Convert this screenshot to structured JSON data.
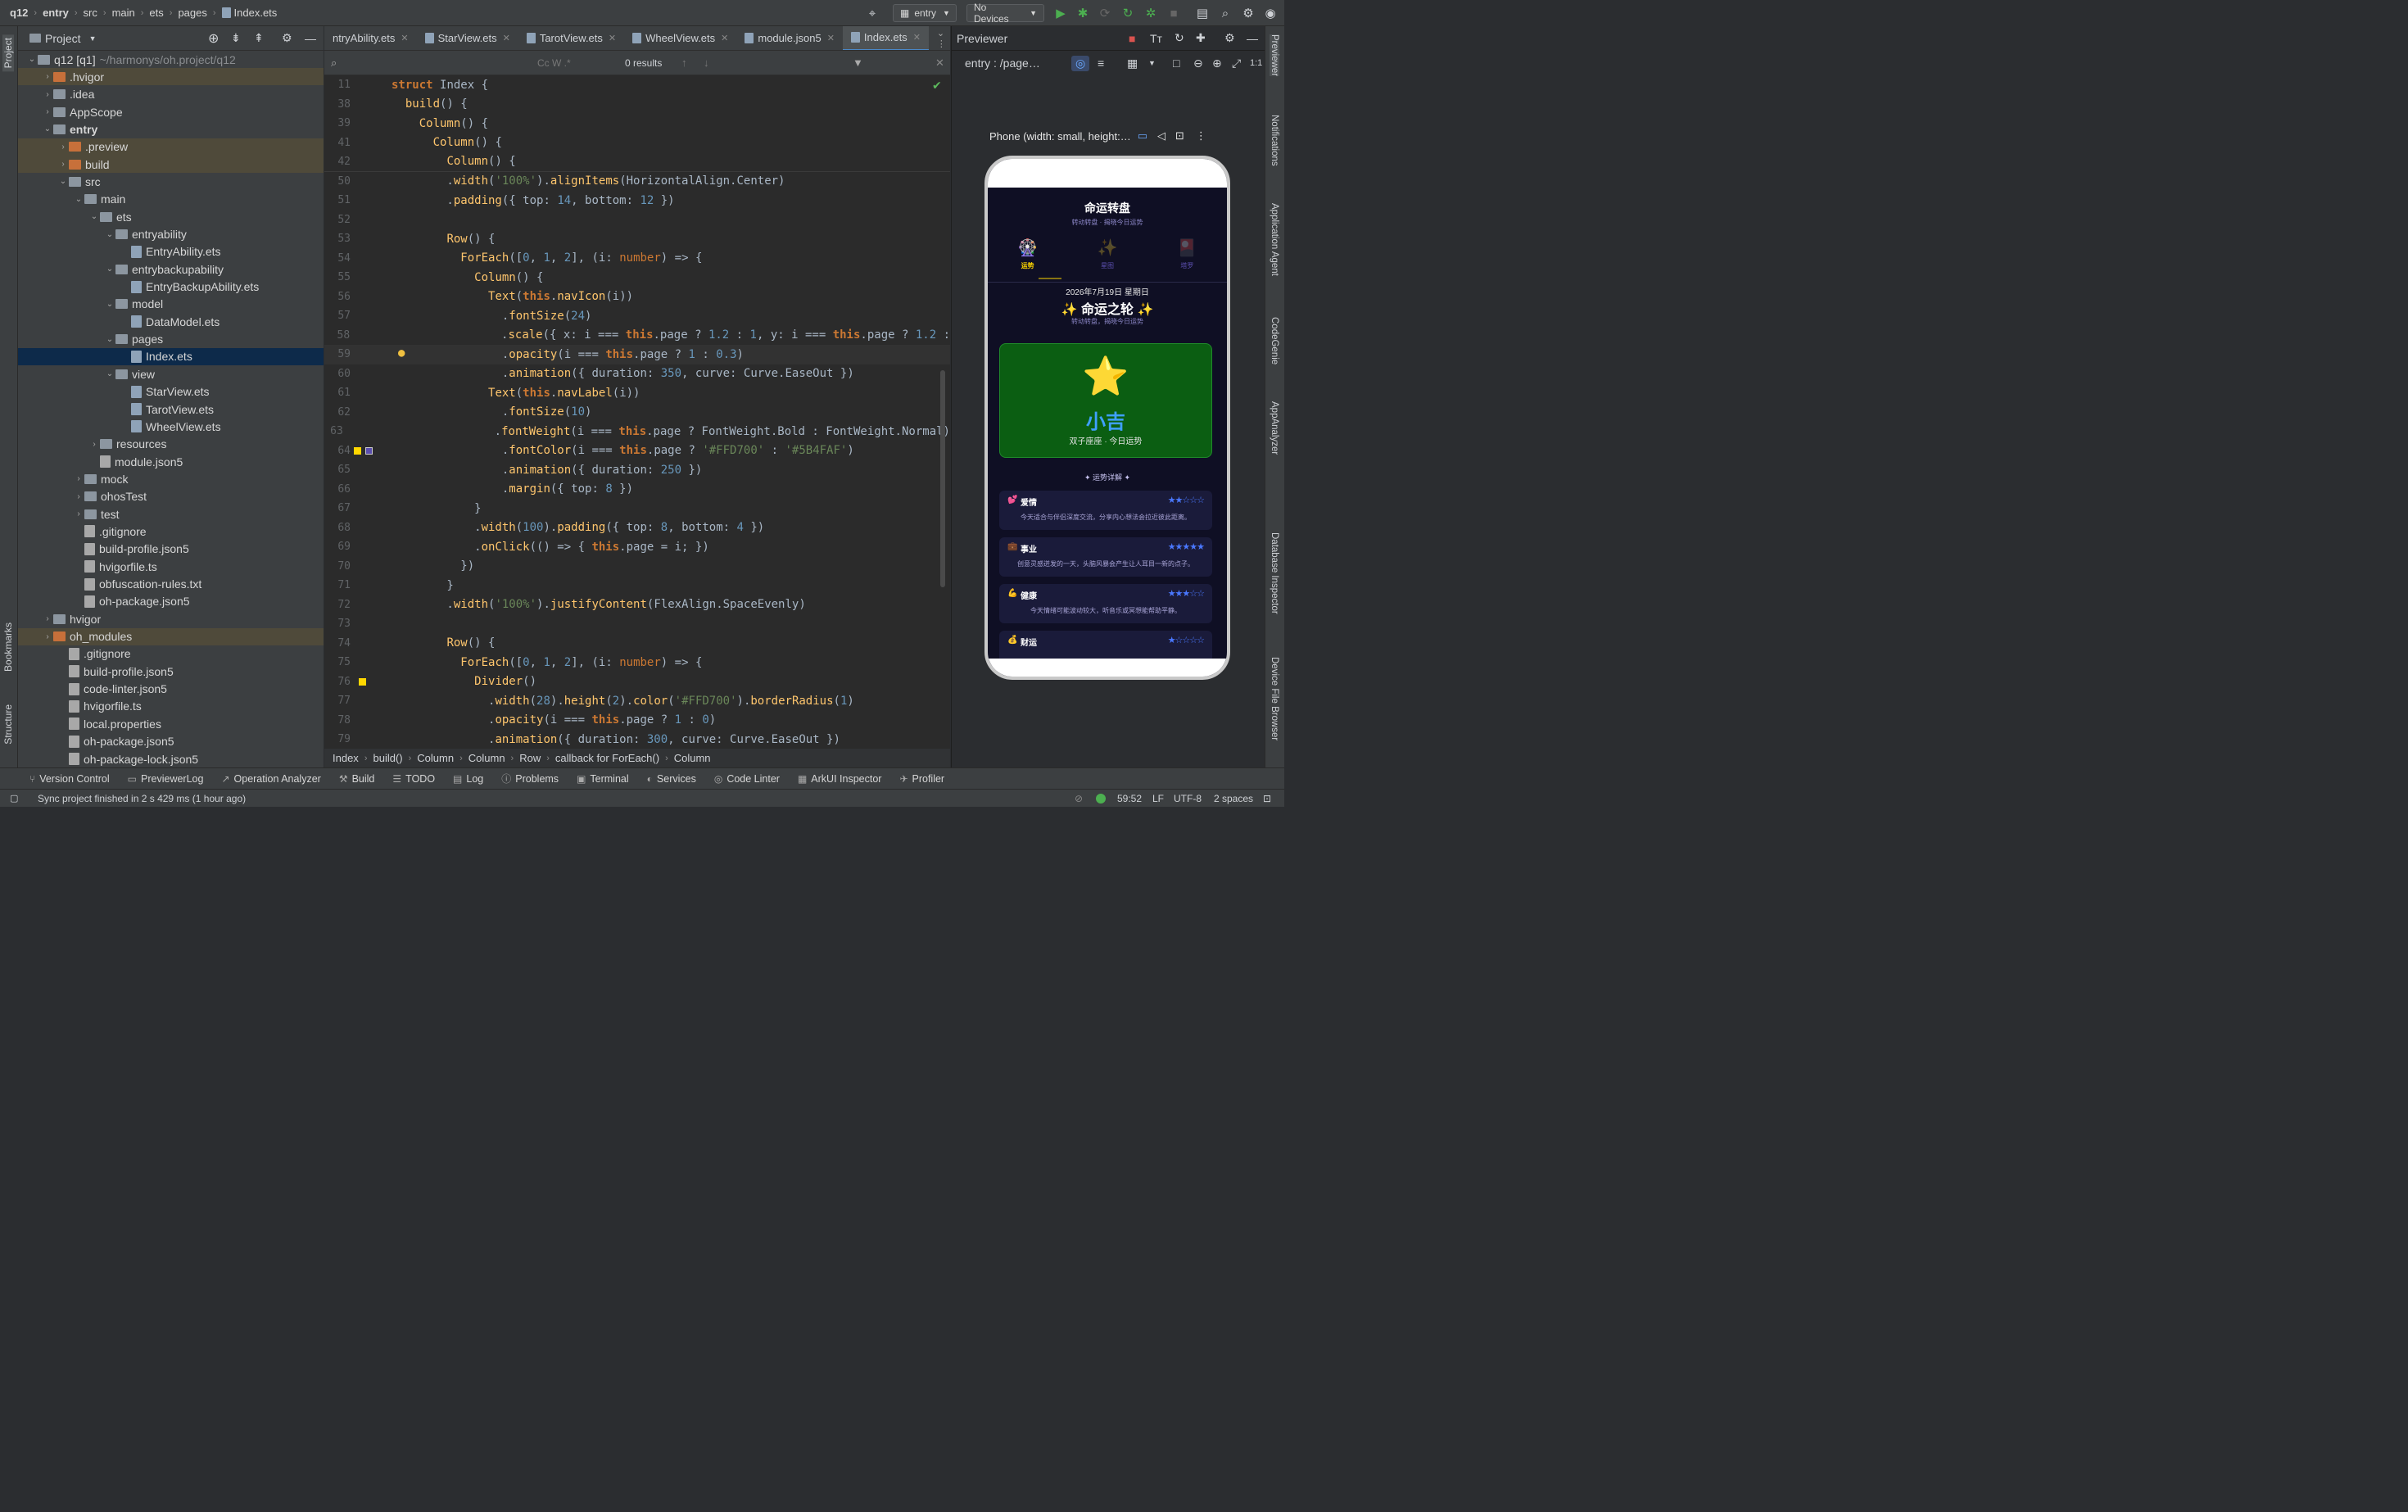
{
  "breadcrumb": [
    "q12",
    "entry",
    "src",
    "main",
    "ets",
    "pages",
    "Index.ets"
  ],
  "toolbar": {
    "run_config": "entry",
    "devices": "No Devices"
  },
  "left_strip": {
    "project": "Project",
    "bookmarks": "Bookmarks",
    "structure": "Structure"
  },
  "project_panel": {
    "title": "Project"
  },
  "tree": [
    {
      "label": "q12 [q1]",
      "extra": "~/harmonys/oh.project/q12",
      "depth": 0,
      "kind": "folder",
      "open": true
    },
    {
      "label": ".hvigor",
      "depth": 1,
      "kind": "folder-orange",
      "hl": true
    },
    {
      "label": ".idea",
      "depth": 1,
      "kind": "folder"
    },
    {
      "label": "AppScope",
      "depth": 1,
      "kind": "folder"
    },
    {
      "label": "entry",
      "depth": 1,
      "kind": "folder",
      "open": true,
      "bold": true
    },
    {
      "label": ".preview",
      "depth": 2,
      "kind": "folder-orange",
      "hl": true
    },
    {
      "label": "build",
      "depth": 2,
      "kind": "folder-orange",
      "hl": true
    },
    {
      "label": "src",
      "depth": 2,
      "kind": "folder",
      "open": true
    },
    {
      "label": "main",
      "depth": 3,
      "kind": "folder",
      "open": true
    },
    {
      "label": "ets",
      "depth": 4,
      "kind": "folder",
      "open": true
    },
    {
      "label": "entryability",
      "depth": 5,
      "kind": "folder",
      "open": true
    },
    {
      "label": "EntryAbility.ets",
      "depth": 6,
      "kind": "ets"
    },
    {
      "label": "entrybackupability",
      "depth": 5,
      "kind": "folder",
      "open": true
    },
    {
      "label": "EntryBackupAbility.ets",
      "depth": 6,
      "kind": "ets"
    },
    {
      "label": "model",
      "depth": 5,
      "kind": "folder",
      "open": true
    },
    {
      "label": "DataModel.ets",
      "depth": 6,
      "kind": "ets"
    },
    {
      "label": "pages",
      "depth": 5,
      "kind": "folder",
      "open": true
    },
    {
      "label": "Index.ets",
      "depth": 6,
      "kind": "ets",
      "sel": true
    },
    {
      "label": "view",
      "depth": 5,
      "kind": "folder",
      "open": true
    },
    {
      "label": "StarView.ets",
      "depth": 6,
      "kind": "ets"
    },
    {
      "label": "TarotView.ets",
      "depth": 6,
      "kind": "ets"
    },
    {
      "label": "WheelView.ets",
      "depth": 6,
      "kind": "ets"
    },
    {
      "label": "resources",
      "depth": 4,
      "kind": "folder",
      "closed": true
    },
    {
      "label": "module.json5",
      "depth": 4,
      "kind": "json"
    },
    {
      "label": "mock",
      "depth": 3,
      "kind": "folder",
      "closed": true
    },
    {
      "label": "ohosTest",
      "depth": 3,
      "kind": "folder",
      "closed": true
    },
    {
      "label": "test",
      "depth": 3,
      "kind": "folder",
      "closed": true
    },
    {
      "label": ".gitignore",
      "depth": 3,
      "kind": "json"
    },
    {
      "label": "build-profile.json5",
      "depth": 3,
      "kind": "json"
    },
    {
      "label": "hvigorfile.ts",
      "depth": 3,
      "kind": "json"
    },
    {
      "label": "obfuscation-rules.txt",
      "depth": 3,
      "kind": "json"
    },
    {
      "label": "oh-package.json5",
      "depth": 3,
      "kind": "json"
    },
    {
      "label": "hvigor",
      "depth": 1,
      "kind": "folder",
      "closed": true
    },
    {
      "label": "oh_modules",
      "depth": 1,
      "kind": "folder-orange",
      "closed": true,
      "hl": true
    },
    {
      "label": ".gitignore",
      "depth": 2,
      "kind": "json"
    },
    {
      "label": "build-profile.json5",
      "depth": 2,
      "kind": "json"
    },
    {
      "label": "code-linter.json5",
      "depth": 2,
      "kind": "json"
    },
    {
      "label": "hvigorfile.ts",
      "depth": 2,
      "kind": "json"
    },
    {
      "label": "local.properties",
      "depth": 2,
      "kind": "json"
    },
    {
      "label": "oh-package.json5",
      "depth": 2,
      "kind": "json"
    },
    {
      "label": "oh-package-lock.json5",
      "depth": 2,
      "kind": "json"
    }
  ],
  "tabs": [
    "ntryAbility.ets",
    "StarView.ets",
    "TarotView.ets",
    "WheelView.ets",
    "module.json5",
    "Index.ets"
  ],
  "find": {
    "results": "0 results"
  },
  "code": [
    {
      "n": "11",
      "html": "<span class='k'>struct</span> <span class='cl'>Index</span> {"
    },
    {
      "n": "38",
      "html": "  <span class='f'>build</span>() {"
    },
    {
      "n": "39",
      "html": "    <span class='f'>Column</span>() {"
    },
    {
      "n": "41",
      "html": "      <span class='f'>Column</span>() {"
    },
    {
      "n": "42",
      "html": "        <span class='f'>Column</span>() {"
    },
    {
      "n": "50",
      "html": "        .<span class='f'>width</span>(<span class='s'>'100%'</span>).<span class='f'>alignItems</span>(HorizontalAlign.Center)"
    },
    {
      "n": "51",
      "html": "        .<span class='f'>padding</span>({ top: <span class='n'>14</span>, bottom: <span class='n'>12</span> })"
    },
    {
      "n": "52",
      "html": ""
    },
    {
      "n": "53",
      "html": "        <span class='f'>Row</span>() {"
    },
    {
      "n": "54",
      "html": "          <span class='f'>ForEach</span>([<span class='n'>0</span>, <span class='n'>1</span>, <span class='n'>2</span>], (i: <span class='t'>number</span>) => {"
    },
    {
      "n": "55",
      "html": "            <span class='f'>Column</span>() {"
    },
    {
      "n": "56",
      "html": "              <span class='f'>Text</span>(<span class='k'>this</span>.<span class='f'>navIcon</span>(i))"
    },
    {
      "n": "57",
      "html": "                .<span class='f'>fontSize</span>(<span class='n'>24</span>)"
    },
    {
      "n": "58",
      "html": "                .<span class='f'>scale</span>({ x: i === <span class='k'>this</span>.page ? <span class='n'>1.2</span> : <span class='n'>1</span>, y: i === <span class='k'>this</span>.page ? <span class='n'>1.2</span> :"
    },
    {
      "n": "59",
      "html": "                .<span class='f'>opacity</span>(i === <span class='k'>this</span>.page ? <span class='n'>1</span> : <span class='n'>0.3</span>)",
      "cur": true
    },
    {
      "n": "60",
      "html": "                .<span class='f'>animation</span>({ duration: <span class='n'>350</span>, curve: Curve.EaseOut })"
    },
    {
      "n": "61",
      "html": "              <span class='f'>Text</span>(<span class='k'>this</span>.<span class='f'>navLabel</span>(i))"
    },
    {
      "n": "62",
      "html": "                .<span class='f'>fontSize</span>(<span class='n'>10</span>)"
    },
    {
      "n": "63",
      "html": "                .<span class='f'>fontWeight</span>(i === <span class='k'>this</span>.page ? FontWeight.Bold : FontWeight.Normal)"
    },
    {
      "n": "64",
      "html": "                .<span class='f'>fontColor</span>(i === <span class='k'>this</span>.page ? <span class='s'>'#FFD700'</span> : <span class='s'>'#5B4FAF'</span>)"
    },
    {
      "n": "65",
      "html": "                .<span class='f'>animation</span>({ duration: <span class='n'>250</span> })"
    },
    {
      "n": "66",
      "html": "                .<span class='f'>margin</span>({ top: <span class='n'>8</span> })"
    },
    {
      "n": "67",
      "html": "            }"
    },
    {
      "n": "68",
      "html": "            .<span class='f'>width</span>(<span class='n'>100</span>).<span class='f'>padding</span>({ top: <span class='n'>8</span>, bottom: <span class='n'>4</span> })"
    },
    {
      "n": "69",
      "html": "            .<span class='f'>onClick</span>(() => { <span class='k'>this</span>.page = i; })"
    },
    {
      "n": "70",
      "html": "          })"
    },
    {
      "n": "71",
      "html": "        }"
    },
    {
      "n": "72",
      "html": "        .<span class='f'>width</span>(<span class='s'>'100%'</span>).<span class='f'>justifyContent</span>(FlexAlign.SpaceEvenly)"
    },
    {
      "n": "73",
      "html": ""
    },
    {
      "n": "74",
      "html": "        <span class='f'>Row</span>() {"
    },
    {
      "n": "75",
      "html": "          <span class='f'>ForEach</span>([<span class='n'>0</span>, <span class='n'>1</span>, <span class='n'>2</span>], (i: <span class='t'>number</span>) => {"
    },
    {
      "n": "76",
      "html": "            <span class='f'>Divider</span>()"
    },
    {
      "n": "77",
      "html": "              .<span class='f'>width</span>(<span class='n'>28</span>).<span class='f'>height</span>(<span class='n'>2</span>).<span class='f'>color</span>(<span class='s'>'#FFD700'</span>).<span class='f'>borderRadius</span>(<span class='n'>1</span>)"
    },
    {
      "n": "78",
      "html": "              .<span class='f'>opacity</span>(i === <span class='k'>this</span>.page ? <span class='n'>1</span> : <span class='n'>0</span>)"
    },
    {
      "n": "79",
      "html": "              .<span class='f'>animation</span>({ duration: <span class='n'>300</span>, curve: Curve.EaseOut })"
    }
  ],
  "code_breadcrumb": [
    "Index",
    "build()",
    "Column",
    "Column",
    "Row",
    "callback for ForEach()",
    "Column"
  ],
  "previewer": {
    "title": "Previewer",
    "entry": "entry : /page…",
    "device": "Phone (width: small, height:…"
  },
  "phone": {
    "title": "命运转盘",
    "subtitle": "转动转盘 · 揭晓今日运势",
    "nav": [
      {
        "icon": "🎡",
        "label": "运势"
      },
      {
        "icon": "✨",
        "label": "星图"
      },
      {
        "icon": "🎴",
        "label": "塔罗"
      }
    ],
    "date": "2026年7月19日 星期日",
    "heading": "✨ 命运之轮 ✨",
    "heading_sub": "转动转盘，揭晓今日运势",
    "result_icon": "⭐",
    "result": "小吉",
    "result_sub": "双子座座 · 今日运势",
    "detail_title": "✦ 运势详解 ✦",
    "items": [
      {
        "icon": "💕",
        "title": "爱情",
        "stars": "★★☆☆☆",
        "text": "今天适合与伴侣深度交流，分享内心想法会拉近彼此距离。"
      },
      {
        "icon": "💼",
        "title": "事业",
        "stars": "★★★★★",
        "text": "创意灵感迸发的一天，头脑风暴会产生让人耳目一新的点子。"
      },
      {
        "icon": "💪",
        "title": "健康",
        "stars": "★★★☆☆",
        "text": "今天情绪可能波动较大，听音乐或冥想能帮助平静。"
      },
      {
        "icon": "💰",
        "title": "财运",
        "stars": "★☆☆☆☆",
        "text": ""
      }
    ]
  },
  "right_strip": [
    "Previewer",
    "Notifications",
    "Application Agent",
    "CodeGenie",
    "AppAnalyzer",
    "Database Inspector",
    "Device File Browser"
  ],
  "bottom_tools": [
    "Version Control",
    "PreviewerLog",
    "Operation Analyzer",
    "Build",
    "TODO",
    "Log",
    "Problems",
    "Terminal",
    "Services",
    "Code Linter",
    "ArkUI Inspector",
    "Profiler"
  ],
  "status": {
    "message": "Sync project finished in 2 s 429 ms (1 hour ago)",
    "position": "59:52",
    "line_sep": "LF",
    "encoding": "UTF-8",
    "indent": "2 spaces"
  },
  "colors": {
    "accent": "#4a88c7",
    "gold": "#FFD700",
    "purple": "#5B4FAF",
    "card_green": "#0b5e12"
  }
}
